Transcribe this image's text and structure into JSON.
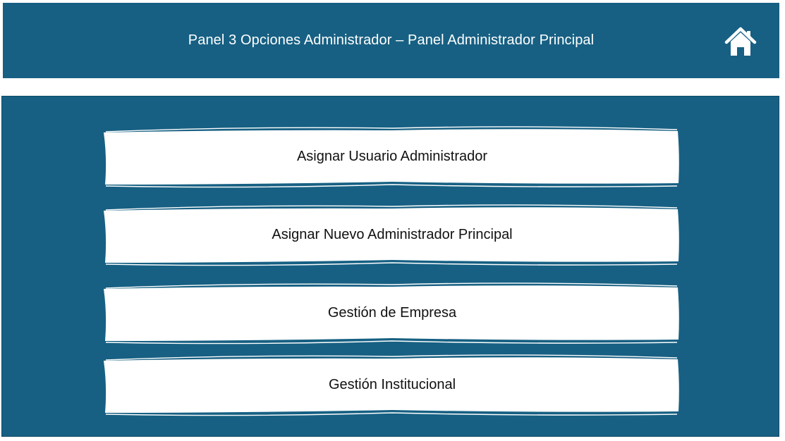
{
  "header": {
    "title": "Panel 3 Opciones Administrador – Panel Administrador Principal",
    "home_icon": "home-icon"
  },
  "colors": {
    "primary": "#176083",
    "option_background": "#ffffff",
    "text_dark": "#111111",
    "text_light": "#ffffff"
  },
  "menu": {
    "options": [
      {
        "label": "Asignar Usuario Administrador"
      },
      {
        "label": "Asignar Nuevo Administrador Principal"
      },
      {
        "label": "Gestión de Empresa"
      },
      {
        "label": "Gestión Institucional"
      }
    ]
  }
}
